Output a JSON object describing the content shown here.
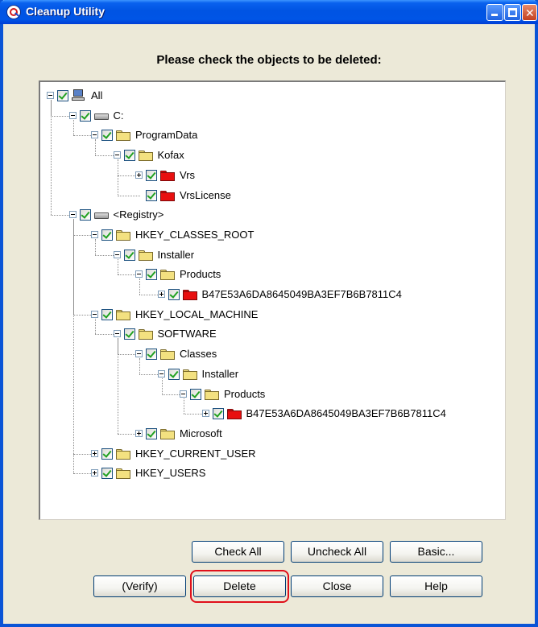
{
  "window": {
    "title": "Cleanup Utility",
    "heading": "Please check the objects to be deleted:"
  },
  "tree": {
    "nodes": [
      {
        "label": "All",
        "icon": "computer-icon",
        "checked": true
      },
      {
        "label": "C:",
        "icon": "drive-icon",
        "checked": true
      },
      {
        "label": "ProgramData",
        "icon": "folder-icon",
        "checked": true
      },
      {
        "label": "Kofax",
        "icon": "folder-icon",
        "checked": true
      },
      {
        "label": "Vrs",
        "icon": "red-folder-icon",
        "checked": true
      },
      {
        "label": "VrsLicense",
        "icon": "red-folder-icon",
        "checked": true
      },
      {
        "label": "<Registry>",
        "icon": "drive-icon",
        "checked": true
      },
      {
        "label": "HKEY_CLASSES_ROOT",
        "icon": "folder-icon",
        "checked": true
      },
      {
        "label": "Installer",
        "icon": "folder-icon",
        "checked": true
      },
      {
        "label": "Products",
        "icon": "folder-icon",
        "checked": true
      },
      {
        "label": "B47E53A6DA8645049BA3EF7B6B7811C4",
        "icon": "red-folder-icon",
        "checked": true
      },
      {
        "label": "HKEY_LOCAL_MACHINE",
        "icon": "folder-icon",
        "checked": true
      },
      {
        "label": "SOFTWARE",
        "icon": "folder-icon",
        "checked": true
      },
      {
        "label": "Classes",
        "icon": "folder-icon",
        "checked": true
      },
      {
        "label": "Installer",
        "icon": "folder-icon",
        "checked": true
      },
      {
        "label": "Products",
        "icon": "folder-icon",
        "checked": true
      },
      {
        "label": "B47E53A6DA8645049BA3EF7B6B7811C4",
        "icon": "red-folder-icon",
        "checked": true
      },
      {
        "label": "Microsoft",
        "icon": "folder-icon",
        "checked": true
      },
      {
        "label": "HKEY_CURRENT_USER",
        "icon": "folder-icon",
        "checked": true
      },
      {
        "label": "HKEY_USERS",
        "icon": "folder-icon",
        "checked": true
      }
    ]
  },
  "buttons": {
    "check_all": "Check All",
    "uncheck_all": "Uncheck All",
    "basic": "Basic...",
    "verify": "(Verify)",
    "delete": "Delete",
    "close": "Close",
    "help": "Help"
  },
  "colors": {
    "titlebar": "#0054e3",
    "highlight": "#e0101a",
    "checkmark": "#21a121",
    "folder": "#f3e180",
    "red_folder": "#e81010"
  }
}
